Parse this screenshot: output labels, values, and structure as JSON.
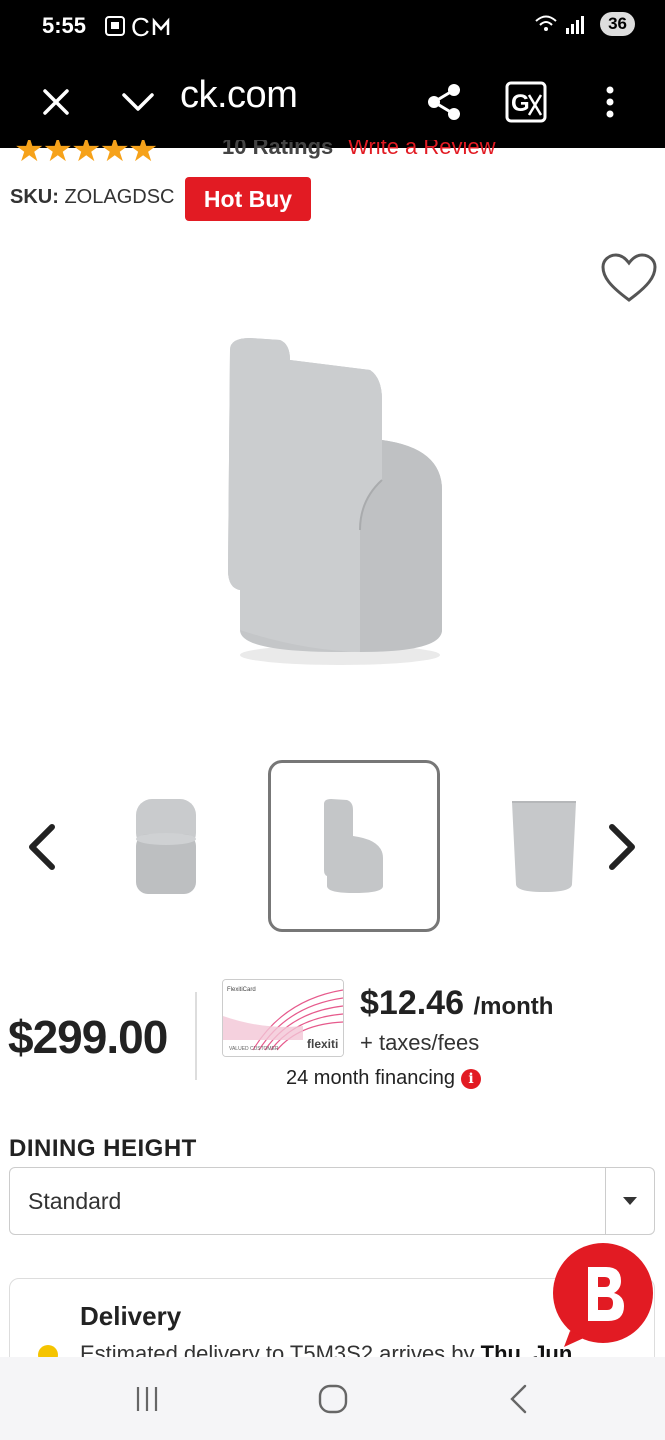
{
  "status_bar": {
    "time": "5:55",
    "battery": "36"
  },
  "browser": {
    "url": "ck.com"
  },
  "product": {
    "ratings_count": "10 Ratings",
    "write_review": "Write a Review",
    "sku_label": "SKU:",
    "sku_value": "ZOLAGDSC",
    "badge": "Hot Buy",
    "rating_stars": 4.5
  },
  "pricing": {
    "price": "$299.00",
    "monthly_amount": "$12.46",
    "monthly_unit": "/month",
    "taxes": "+ taxes/fees",
    "financing": "24 month financing",
    "card_brand": "FlexitiCard",
    "card_logo": "flexiti",
    "card_holder": "VALUED CUSTOMER"
  },
  "options": {
    "label": "DINING HEIGHT",
    "selected": "Standard"
  },
  "delivery": {
    "title": "Delivery",
    "text_prefix": "Estimated delivery to T5M3S2 arrives by",
    "text_bold": "Thu, Jun"
  },
  "colors": {
    "brand_red": "#e21b23",
    "star_orange": "#f6a21a",
    "status_yellow": "#f5c400"
  }
}
